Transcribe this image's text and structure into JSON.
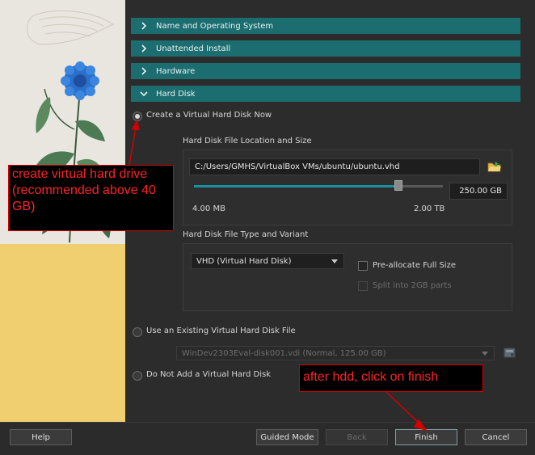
{
  "sections": [
    {
      "label": "Name and Operating System",
      "expanded": false
    },
    {
      "label": "Unattended Install",
      "expanded": false
    },
    {
      "label": "Hardware",
      "expanded": false
    },
    {
      "label": "Hard Disk",
      "expanded": true
    }
  ],
  "hard_disk": {
    "option_create": "Create a Virtual Hard Disk Now",
    "location_group_label": "Hard Disk File Location and Size",
    "file_path": "C:/Users/GMHS/VirtualBox VMs/ubuntu/ubuntu.vhd",
    "size_value": "250.00 GB",
    "size_min_label": "4.00 MB",
    "size_max_label": "2.00 TB",
    "size_slider_fraction": 0.82,
    "type_group_label": "Hard Disk File Type and Variant",
    "type_selected": "VHD (Virtual Hard Disk)",
    "preallocate_label": "Pre-allocate Full Size",
    "split_label": "Split into 2GB parts",
    "option_existing": "Use an Existing Virtual Hard Disk File",
    "existing_file": "WinDev2303Eval-disk001.vdi (Normal, 125.00 GB)",
    "option_none": "Do Not Add a Virtual Hard Disk"
  },
  "buttons": {
    "help": "Help",
    "guided_mode": "Guided Mode",
    "back": "Back",
    "finish": "Finish",
    "cancel": "Cancel"
  },
  "annotations": {
    "create_note": "create virtual hard drive (recommended above 40 GB)",
    "finish_note": "after hdd, click on finish"
  },
  "colors": {
    "section_header": "#1b6d70",
    "annotation_red": "#ff2323",
    "art_yellow": "#f0cf71",
    "flower_blue": "#2b6fc9"
  },
  "icons": {
    "folder": "folder-open-icon",
    "disk_browse": "disk-browse-icon"
  }
}
